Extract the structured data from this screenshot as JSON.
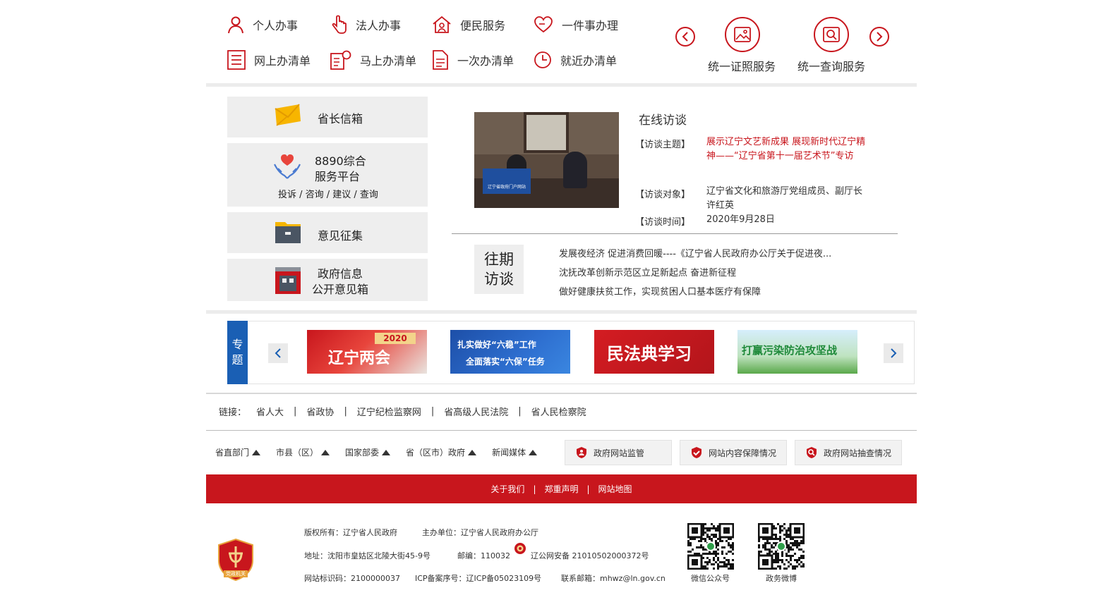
{
  "services": {
    "row1": [
      {
        "label": "个人办事",
        "icon": "person-icon"
      },
      {
        "label": "法人办事",
        "icon": "hand-icon"
      },
      {
        "label": "便民服务",
        "icon": "house-people-icon"
      },
      {
        "label": "一件事办理",
        "icon": "heart-hand-icon"
      }
    ],
    "row2": [
      {
        "label": "网上办清单",
        "icon": "list-icon"
      },
      {
        "label": "马上办清单",
        "icon": "clock-doc-icon"
      },
      {
        "label": "一次办清单",
        "icon": "document-icon"
      },
      {
        "label": "就近办清单",
        "icon": "clock-icon"
      }
    ],
    "cert_label": "统一证照服务",
    "query_label": "统一查询服务"
  },
  "left_boxes": {
    "mailbox": "省长信箱",
    "hotline_title_1": "8890综合",
    "hotline_title_2": "服务平台",
    "hotline_sub": "投诉 / 咨询 / 建议 / 查询",
    "opinion": "意见征集",
    "gov_info_1": "政府信息",
    "gov_info_2": "公开意见箱"
  },
  "interview": {
    "heading": "在线访谈",
    "topic_label": "【访谈主题】",
    "topic_value": "展示辽宁文艺新成果 展现新时代辽宁精神——“辽宁省第十一届艺术节”专访",
    "guest_label": "【访谈对象】",
    "guest_value": "辽宁省文化和旅游厅党组成员、副厅长许红英",
    "time_label": "【访谈时间】",
    "time_value": "2020年9月28日",
    "photo_sign": "辽宁省政府门户网站",
    "past_1": "往期",
    "past_2": "访谈",
    "past_items": [
      "发展夜经济 促进消费回暖----《辽宁省人民政府办公厅关于促进夜...",
      "沈抚改革创新示范区立足新起点 奋进新征程",
      "做好健康扶贫工作，实现贫困人口基本医疗有保障"
    ]
  },
  "topics": {
    "tag_1": "专",
    "tag_2": "题",
    "banners": [
      {
        "text": "辽宁两会",
        "sub": "2020"
      },
      {
        "text": "扎实做好“六稳”工作",
        "sub": "全面落实“六保”任务"
      },
      {
        "text": "民法典学习",
        "sub": ""
      },
      {
        "text": "打赢污染防治攻坚战",
        "sub": ""
      }
    ]
  },
  "links": {
    "label": "链接：",
    "items": [
      "省人大",
      "省政协",
      "辽宁纪检监察网",
      "省高级人民法院",
      "省人民检察院"
    ]
  },
  "dropdowns": [
    "省直部门",
    "市县（区）",
    "国家部委",
    "省（区市）政府",
    "新闻媒体"
  ],
  "monitor": [
    "政府网站监管",
    "网站内容保障情况",
    "政府网站抽查情况"
  ],
  "footer": {
    "bar": [
      "关于我们",
      "郑重声明",
      "网站地图"
    ],
    "copyright": "版权所有：辽宁省人民政府",
    "host": "主办单位：辽宁省人民政府办公厅",
    "address": "地址：沈阳市皇姑区北陵大街45-9号",
    "postcode": "邮编：110032",
    "police": "辽公网安备 21010502000372号",
    "site_code": "网站标识码：2100000037",
    "icp": "ICP备案序号：辽ICP备05023109号",
    "email": "联系邮箱：mhwz@ln.gov.cn",
    "badge": "党政机关",
    "qr_wechat": "微信公众号",
    "qr_weibo": "政务微博"
  },
  "colors": {
    "accent": "#c8161d",
    "topic_blue": "#1a5fb4"
  }
}
